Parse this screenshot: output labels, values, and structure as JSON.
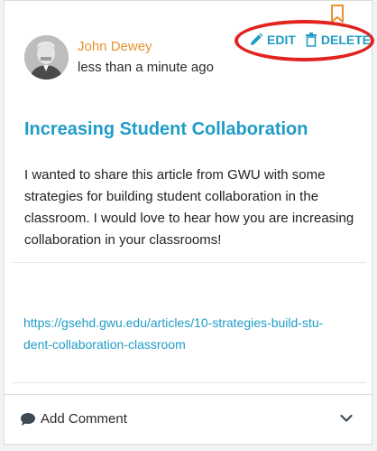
{
  "post": {
    "author": "John Dewey",
    "timestamp": "less than a minute ago",
    "title": "Increasing Student Collaboration",
    "body": "I wanted to share this article from GWU with some strategies for building student collaboration in the classroom. I would love to hear how you are increasing collaboration in your classrooms!",
    "link": "https://gsehd.gwu.edu/articles/10-strategies-build-student-collaboration-classroom",
    "link_display": "https://gsehd.gwu.edu/articles/10-strategies-build-stu-\ndent-collaboration-classroom"
  },
  "actions": {
    "edit_label": "EDIT",
    "delete_label": "DELETE"
  },
  "footer": {
    "add_comment_label": "Add Comment"
  },
  "icons": {
    "bookmark": "bookmark-icon",
    "edit": "pencil-icon",
    "delete": "trash-icon",
    "comment": "speech-bubble-icon",
    "expand": "chevron-down-icon"
  },
  "colors": {
    "author": "#e8912d",
    "accent": "#1f9cc7",
    "highlight_ring": "#e3231e"
  }
}
